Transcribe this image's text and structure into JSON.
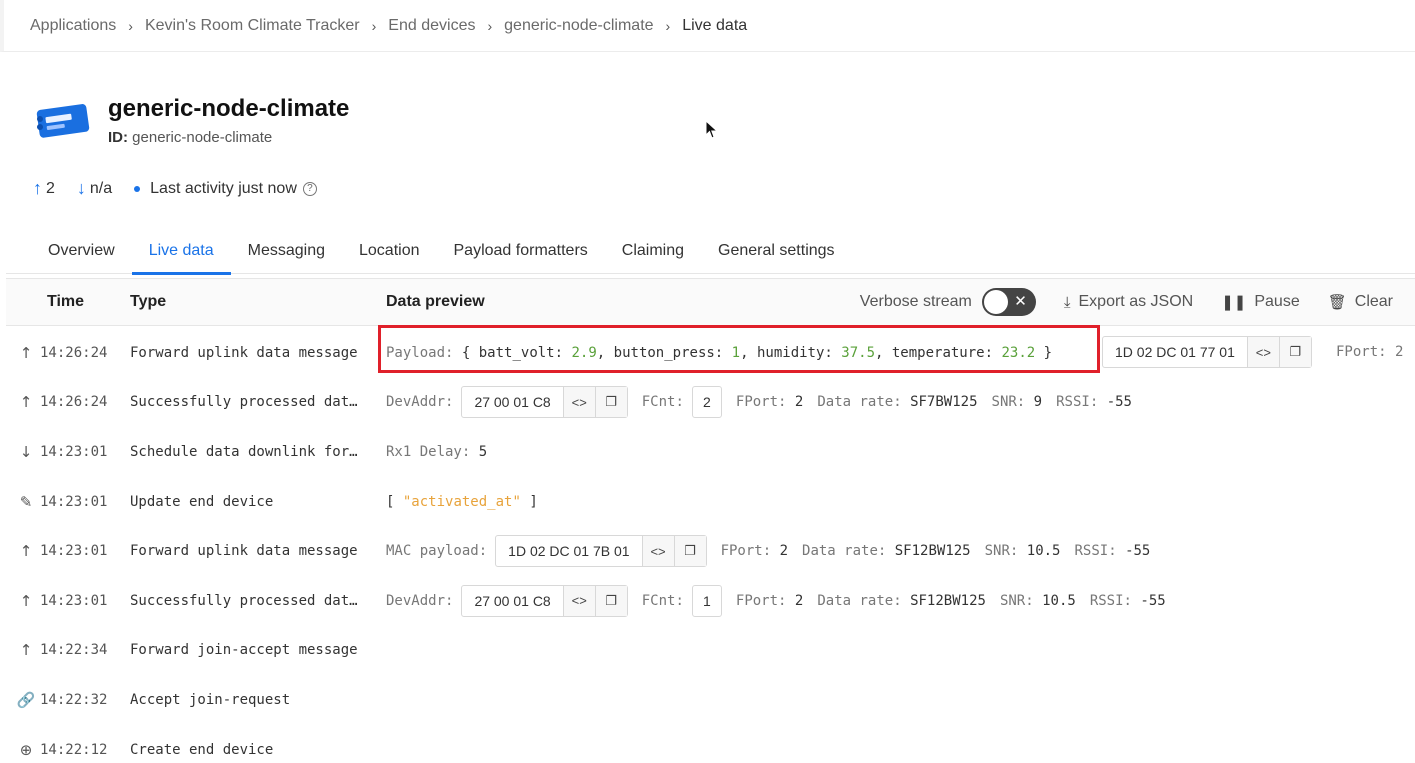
{
  "breadcrumb": {
    "items": [
      "Applications",
      "Kevin's Room Climate Tracker",
      "End devices",
      "generic-node-climate",
      "Live data"
    ]
  },
  "device": {
    "name": "generic-node-climate",
    "id_label": "ID:",
    "id_value": "generic-node-climate",
    "uplink_count": "2",
    "downlink_count": "n/a",
    "last_activity": "Last activity just now"
  },
  "tabs": [
    "Overview",
    "Live data",
    "Messaging",
    "Location",
    "Payload formatters",
    "Claiming",
    "General settings"
  ],
  "table": {
    "col_time": "Time",
    "col_type": "Type",
    "col_preview": "Data preview",
    "verbose_label": "Verbose stream",
    "export_label": "Export as JSON",
    "pause_label": "Pause",
    "clear_label": "Clear"
  },
  "rows": [
    {
      "icon": "arrow-up-icon",
      "time": "14:26:24",
      "type": "Forward uplink data message",
      "payload_label": "Payload:",
      "payload": {
        "batt_volt": "2.9",
        "button_press": "1",
        "humidity": "37.5",
        "temperature": "23.2"
      },
      "hex": "1D 02 DC 01 77 01",
      "fport": "FPort: 2"
    },
    {
      "icon": "arrow-up-icon",
      "time": "14:26:24",
      "type": "Successfully processed dat…",
      "devaddr_label": "DevAddr:",
      "devaddr": "27 00 01 C8",
      "fcnt_label": "FCnt:",
      "fcnt": "2",
      "fport_label": "FPort:",
      "fport": "2",
      "rate_label": "Data rate:",
      "rate": "SF7BW125",
      "snr_label": "SNR:",
      "snr": "9",
      "rssi_label": "RSSI:",
      "rssi": "-55"
    },
    {
      "icon": "arrow-down-icon",
      "time": "14:23:01",
      "type": "Schedule data downlink for…",
      "delay_label": "Rx1 Delay:",
      "delay": "5"
    },
    {
      "icon": "pencil-icon",
      "time": "14:23:01",
      "type": "Update end device",
      "fields": "\"activated_at\""
    },
    {
      "icon": "arrow-up-icon",
      "time": "14:23:01",
      "type": "Forward uplink data message",
      "mac_label": "MAC payload:",
      "mac": "1D 02 DC 01 7B 01",
      "fport_label": "FPort:",
      "fport": "2",
      "rate_label": "Data rate:",
      "rate": "SF12BW125",
      "snr_label": "SNR:",
      "snr": "10.5",
      "rssi_label": "RSSI:",
      "rssi": "-55"
    },
    {
      "icon": "arrow-up-icon",
      "time": "14:23:01",
      "type": "Successfully processed dat…",
      "devaddr_label": "DevAddr:",
      "devaddr": "27 00 01 C8",
      "fcnt_label": "FCnt:",
      "fcnt": "1",
      "fport_label": "FPort:",
      "fport": "2",
      "rate_label": "Data rate:",
      "rate": "SF12BW125",
      "snr_label": "SNR:",
      "snr": "10.5",
      "rssi_label": "RSSI:",
      "rssi": "-55"
    },
    {
      "icon": "arrow-up-icon",
      "time": "14:22:34",
      "type": "Forward join-accept message"
    },
    {
      "icon": "link-icon",
      "time": "14:22:32",
      "type": "Accept join-request"
    },
    {
      "icon": "plus-circle-icon",
      "time": "14:22:12",
      "type": "Create end device"
    }
  ],
  "colors": {
    "accent": "#1a73e8",
    "highlight": "#e0202a",
    "number": "#5aa13a",
    "string": "#e8a33b"
  }
}
